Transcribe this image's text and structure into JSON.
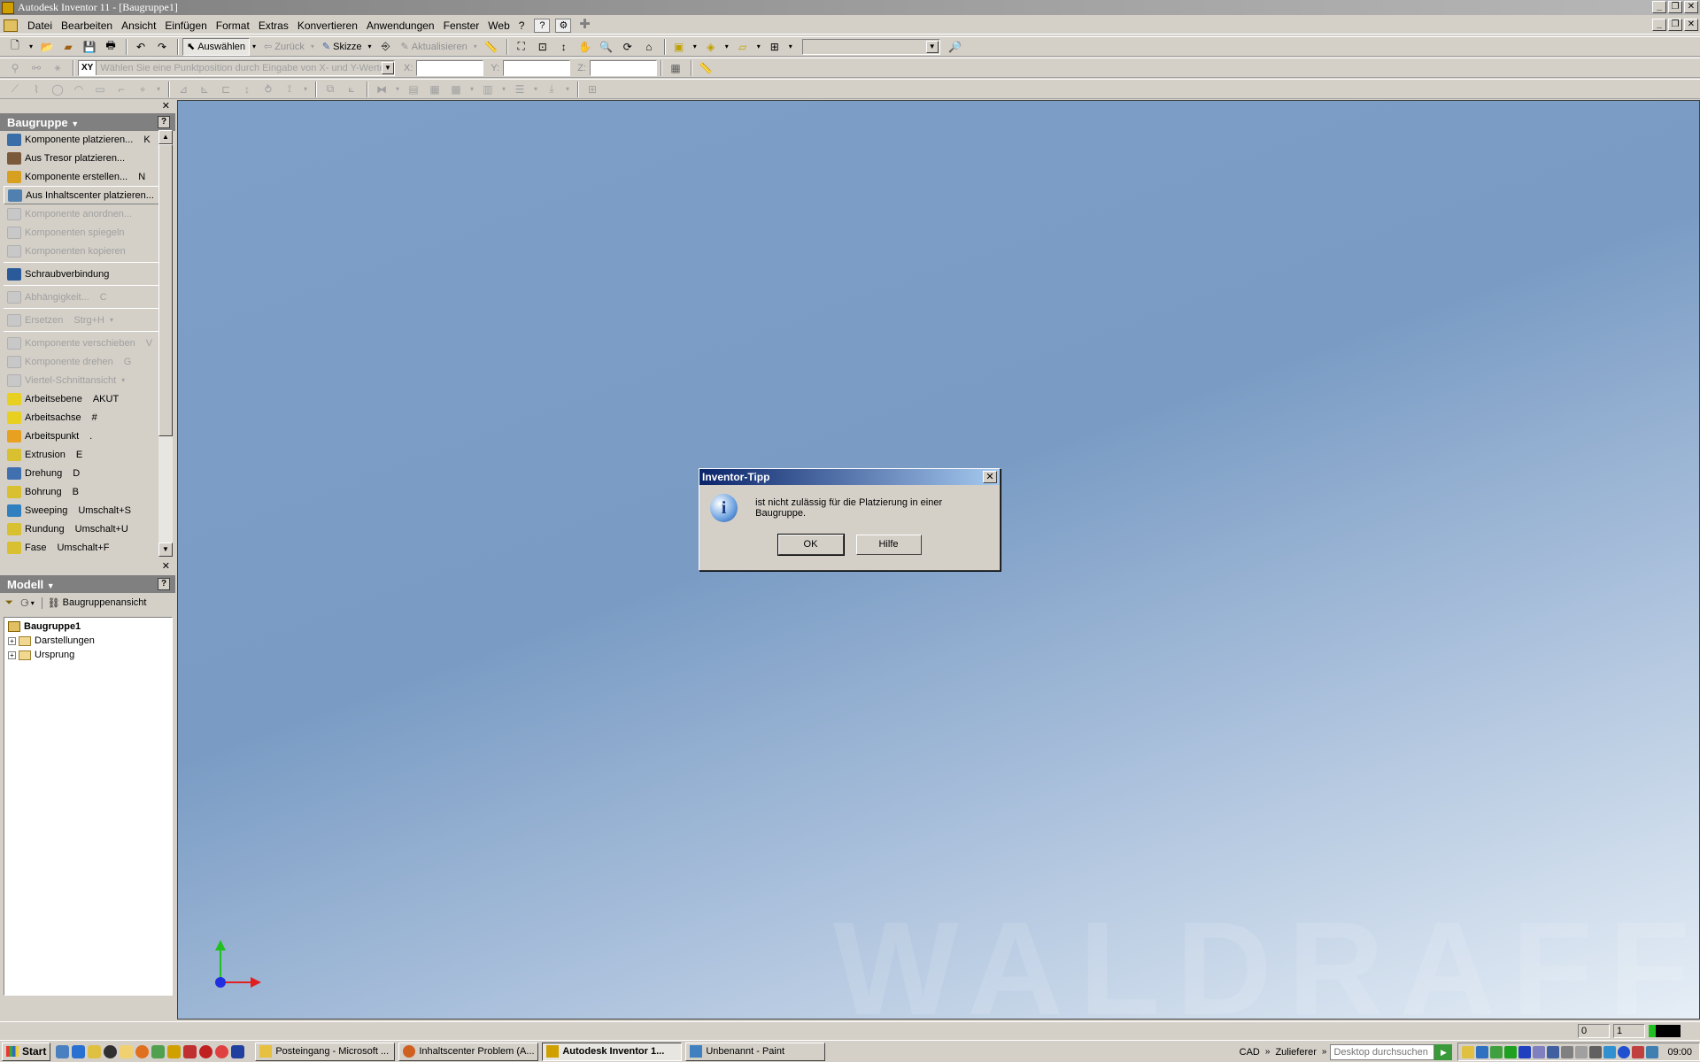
{
  "window": {
    "title": "Autodesk Inventor 11 - [Baugruppe1]"
  },
  "menu": {
    "items": [
      "Datei",
      "Bearbeiten",
      "Ansicht",
      "Einfügen",
      "Format",
      "Extras",
      "Konvertieren",
      "Anwendungen",
      "Fenster",
      "Web",
      "?"
    ]
  },
  "toolbar": {
    "select_label": "Auswählen",
    "back_label": "Zurück",
    "sketch_label": "Skizze",
    "update_label": "Aktualisieren"
  },
  "coords": {
    "xy_label": "XY",
    "hint": "Wählen Sie eine Punktposition durch Eingabe von X- und Y-Werten.",
    "x_label": "X:",
    "y_label": "Y:",
    "z_label": "Z:",
    "x_value": "",
    "y_value": "",
    "z_value": ""
  },
  "assembly_panel": {
    "title": "Baugruppe",
    "commands": [
      {
        "label": "Komponente platzieren...",
        "shortcut": "K",
        "enabled": true,
        "color": "#3a6ea8"
      },
      {
        "label": "Aus Tresor platzieren...",
        "shortcut": "",
        "enabled": true,
        "color": "#7a5a3a"
      },
      {
        "label": "Komponente erstellen...",
        "shortcut": "N",
        "enabled": true,
        "color": "#d8a020"
      },
      {
        "label": "Aus Inhaltscenter platzieren...",
        "shortcut": "",
        "enabled": true,
        "color": "#5080b0"
      },
      {
        "label": "Komponente anordnen...",
        "shortcut": "",
        "enabled": false,
        "color": ""
      },
      {
        "label": "Komponenten spiegeln",
        "shortcut": "",
        "enabled": false,
        "color": ""
      },
      {
        "label": "Komponenten kopieren",
        "shortcut": "",
        "enabled": false,
        "color": ""
      },
      {
        "label": "Schraubverbindung",
        "shortcut": "",
        "enabled": true,
        "color": "#2a5a9a"
      },
      {
        "label": "Abhängigkeit...",
        "shortcut": "C",
        "enabled": false,
        "color": ""
      },
      {
        "label": "Ersetzen",
        "shortcut": "Strg+H",
        "enabled": false,
        "color": ""
      },
      {
        "label": "Komponente verschieben",
        "shortcut": "V",
        "enabled": false,
        "color": ""
      },
      {
        "label": "Komponente drehen",
        "shortcut": "G",
        "enabled": false,
        "color": ""
      },
      {
        "label": "Viertel-Schnittansicht",
        "shortcut": "",
        "enabled": false,
        "color": ""
      },
      {
        "label": "Arbeitsebene",
        "shortcut": "AKUT",
        "enabled": true,
        "color": "#e8d020"
      },
      {
        "label": "Arbeitsachse",
        "shortcut": "#",
        "enabled": true,
        "color": "#e8d020"
      },
      {
        "label": "Arbeitspunkt",
        "shortcut": ".",
        "enabled": true,
        "color": "#e8a020"
      },
      {
        "label": "Extrusion",
        "shortcut": "E",
        "enabled": true,
        "color": "#d8c030"
      },
      {
        "label": "Drehung",
        "shortcut": "D",
        "enabled": true,
        "color": "#4070b0"
      },
      {
        "label": "Bohrung",
        "shortcut": "B",
        "enabled": true,
        "color": "#d8c030"
      },
      {
        "label": "Sweeping",
        "shortcut": "Umschalt+S",
        "enabled": true,
        "color": "#3080c0"
      },
      {
        "label": "Rundung",
        "shortcut": "Umschalt+U",
        "enabled": true,
        "color": "#d8c030"
      },
      {
        "label": "Fase",
        "shortcut": "Umschalt+F",
        "enabled": true,
        "color": "#d8c030"
      }
    ]
  },
  "model_panel": {
    "title": "Modell",
    "view_label": "Baugruppenansicht",
    "tree": [
      {
        "label": "Baugruppe1",
        "bold": true,
        "expander": false
      },
      {
        "label": "Darstellungen",
        "bold": false,
        "expander": true
      },
      {
        "label": "Ursprung",
        "bold": false,
        "expander": true
      }
    ]
  },
  "viewport": {
    "watermark": "WALDRAFF",
    "background_top": "#7ea0c8",
    "background_bottom": "#e6eef6"
  },
  "dialog": {
    "title": "Inventor-Tipp",
    "message": "ist nicht zulässig für die Platzierung in einer Baugruppe.",
    "ok_label": "OK",
    "help_label": "Hilfe"
  },
  "statusbar": {
    "field1": "0",
    "field2": "1"
  },
  "taskbar": {
    "start_label": "Start",
    "tasks": [
      {
        "label": "Posteingang - Microsoft ...",
        "active": false,
        "color": "#e8c040"
      },
      {
        "label": "Inhaltscenter Problem (A...",
        "active": false,
        "color": "#d06020"
      },
      {
        "label": "Autodesk Inventor 1...",
        "active": true,
        "color": "#d0a000"
      },
      {
        "label": "Unbenannt - Paint",
        "active": false,
        "color": "#4080c0"
      }
    ],
    "cad_label": "CAD",
    "supplier_label": "Zulieferer",
    "search_placeholder": "Desktop durchsuchen",
    "clock": "09:00"
  }
}
